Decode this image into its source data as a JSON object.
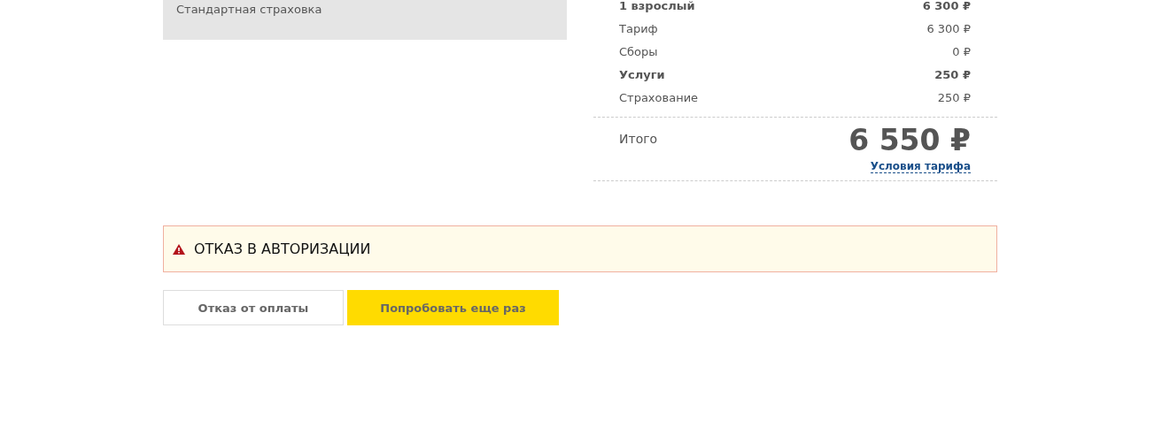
{
  "insurance_panel": {
    "label": "Стандартная страховка"
  },
  "price_rows": [
    {
      "kind": "group",
      "label": "1 взрослый",
      "amount": "6 300 ₽"
    },
    {
      "kind": "item",
      "label": "Тариф",
      "amount": "6 300 ₽"
    },
    {
      "kind": "item",
      "label": "Сборы",
      "amount": "0 ₽"
    },
    {
      "kind": "group",
      "label": "Услуги",
      "amount": "250 ₽"
    },
    {
      "kind": "item",
      "label": "Страхование",
      "amount": "250 ₽"
    }
  ],
  "total": {
    "label": "Итого",
    "amount": "6 550 ₽",
    "link": "Условия тарифа"
  },
  "alert": {
    "message": "ОТКАЗ В АВТОРИЗАЦИИ"
  },
  "buttons": [
    {
      "kind": "secondary",
      "label": "Отказ от оплаты"
    },
    {
      "kind": "primary",
      "label": "Попробовать еще раз"
    }
  ]
}
